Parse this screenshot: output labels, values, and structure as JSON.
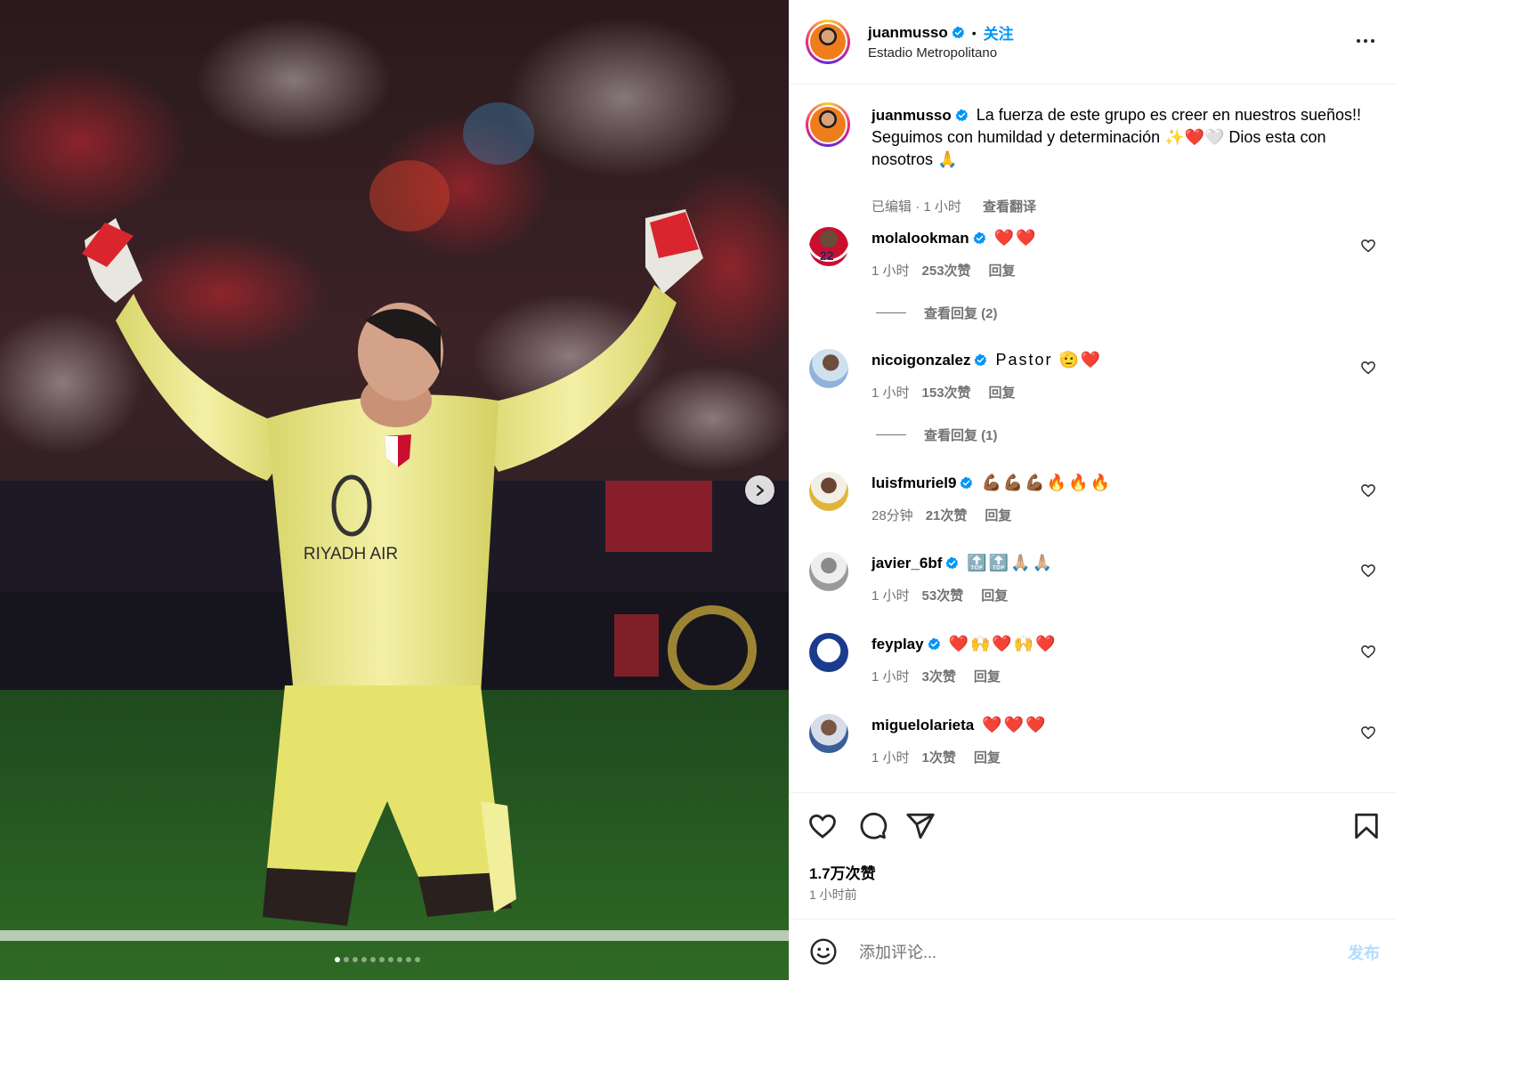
{
  "header": {
    "username": "juanmusso",
    "separator": "•",
    "follow_label": "关注",
    "location": "Estadio Metropolitano"
  },
  "caption": {
    "username": "juanmusso",
    "text": "La fuerza de este grupo es creer en nuestros sueños!! Seguimos con humildad y determinación ✨❤️🤍 Dios esta con nosotros 🙏",
    "edited": "已编辑",
    "dot": "·",
    "time": "1 小时",
    "translate_label": "查看翻译"
  },
  "photo": {
    "jersey_text": "RIYADH AIR",
    "slides_total": 10,
    "active_slide": 1
  },
  "comments": [
    {
      "username": "molalookman",
      "text": "❤️❤️",
      "time": "1 小时",
      "likes": "253次赞",
      "reply": "回复",
      "view_replies": "查看回复 (2)",
      "avatar_color": "#c8102e"
    },
    {
      "username": "nicoigonzalez",
      "text": "Pastor 🫡❤️",
      "time": "1 小时",
      "likes": "153次赞",
      "reply": "回复",
      "view_replies": "查看回复 (1)",
      "avatar_color": "#8fb3d9"
    },
    {
      "username": "luisfmuriel9",
      "text": "💪🏾💪🏾💪🏾🔥🔥🔥",
      "time": "28分钟",
      "likes": "21次赞",
      "reply": "回复",
      "view_replies": "",
      "avatar_color": "#e0b43a"
    },
    {
      "username": "javier_6bf",
      "text": "🔝🔝🙏🏼🙏🏼",
      "time": "1 小时",
      "likes": "53次赞",
      "reply": "回复",
      "view_replies": "",
      "avatar_color": "#9a9a9a"
    },
    {
      "username": "feyplay",
      "text": "❤️🙌❤️🙌❤️",
      "time": "1 小时",
      "likes": "3次赞",
      "reply": "回复",
      "view_replies": "",
      "avatar_color": "#1b3c8c"
    },
    {
      "username": "miguelolarieta",
      "text": "❤️❤️❤️",
      "time": "1 小时",
      "likes": "1次赞",
      "reply": "回复",
      "view_replies": "",
      "avatar_color": "#3a5d9c"
    }
  ],
  "stats": {
    "likes": "1.7万次赞",
    "posted": "1 小时前"
  },
  "composer": {
    "placeholder": "添加评论...",
    "post_label": "发布"
  },
  "icons": {
    "like": "heart-icon",
    "comment": "comment-bubble-icon",
    "share": "paper-plane-icon",
    "save": "bookmark-icon",
    "more": "more-options-icon",
    "emoji": "emoji-smiley-icon",
    "next": "chevron-right-icon",
    "verified": "verified-badge-icon"
  },
  "colors": {
    "accent": "#0095f6",
    "muted": "#737373",
    "verified": "#0095f6",
    "post_disabled": "#b3dbff"
  }
}
